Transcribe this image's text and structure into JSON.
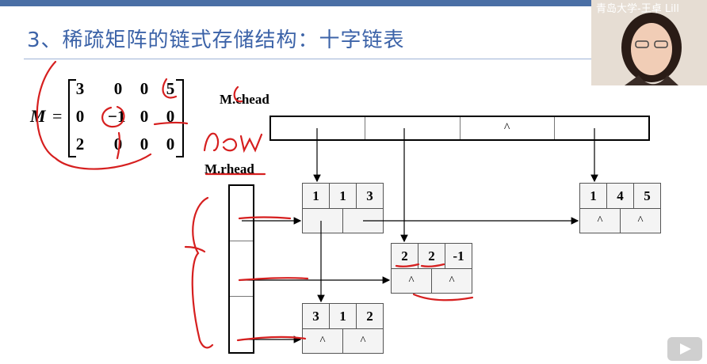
{
  "slide": {
    "title": "3、稀疏矩阵的链式存储结构：十字链表"
  },
  "matrix": {
    "name": "M",
    "equals": "=",
    "rows": [
      [
        "3",
        "0",
        "0",
        "5"
      ],
      [
        "0",
        "−1",
        "0",
        "0"
      ],
      [
        "2",
        "0",
        "0",
        "0"
      ]
    ]
  },
  "labels": {
    "chead": "M.chead",
    "rhead": "M.rhead"
  },
  "chead_cells": [
    "",
    "",
    "^",
    ""
  ],
  "nodes": [
    {
      "row": "1",
      "col": "1",
      "val": "3",
      "down": "",
      "right": ""
    },
    {
      "row": "1",
      "col": "4",
      "val": "5",
      "down": "^",
      "right": "^"
    },
    {
      "row": "2",
      "col": "2",
      "val": "-1",
      "down": "^",
      "right": "^"
    },
    {
      "row": "3",
      "col": "1",
      "val": "2",
      "down": "^",
      "right": "^"
    }
  ],
  "webcam": {
    "caption": "青岛大学-王卓 Lill"
  },
  "annotation": {
    "handwritten": "row"
  },
  "colors": {
    "title": "#3c63a8",
    "ink": "#d61f1f",
    "topbar": "#4a6fa5"
  }
}
